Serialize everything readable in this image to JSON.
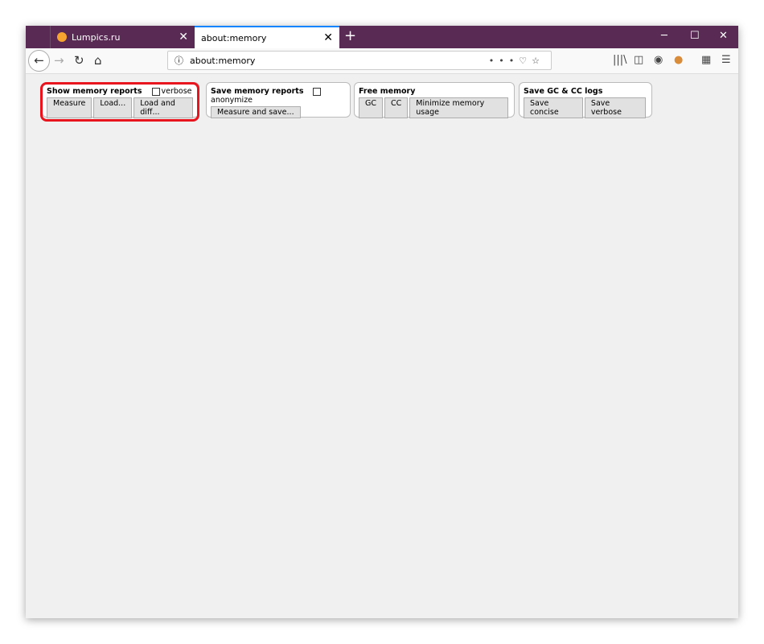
{
  "tabs": [
    {
      "label": "Lumpics.ru"
    },
    {
      "label": "about:memory"
    }
  ],
  "url": "about:memory",
  "sections": [
    {
      "title": "Show memory reports",
      "checkbox": "verbose",
      "buttons": [
        "Measure",
        "Load...",
        "Load and diff..."
      ]
    },
    {
      "title": "Save memory reports",
      "checkbox": "anonymize",
      "buttons": [
        "Measure and save..."
      ]
    },
    {
      "title": "Free memory",
      "buttons": [
        "GC",
        "CC",
        "Minimize memory usage"
      ]
    },
    {
      "title": "Save GC & CC logs",
      "buttons": [
        "Save concise",
        "Save verbose"
      ]
    }
  ],
  "highlight_color": "#e8151f"
}
